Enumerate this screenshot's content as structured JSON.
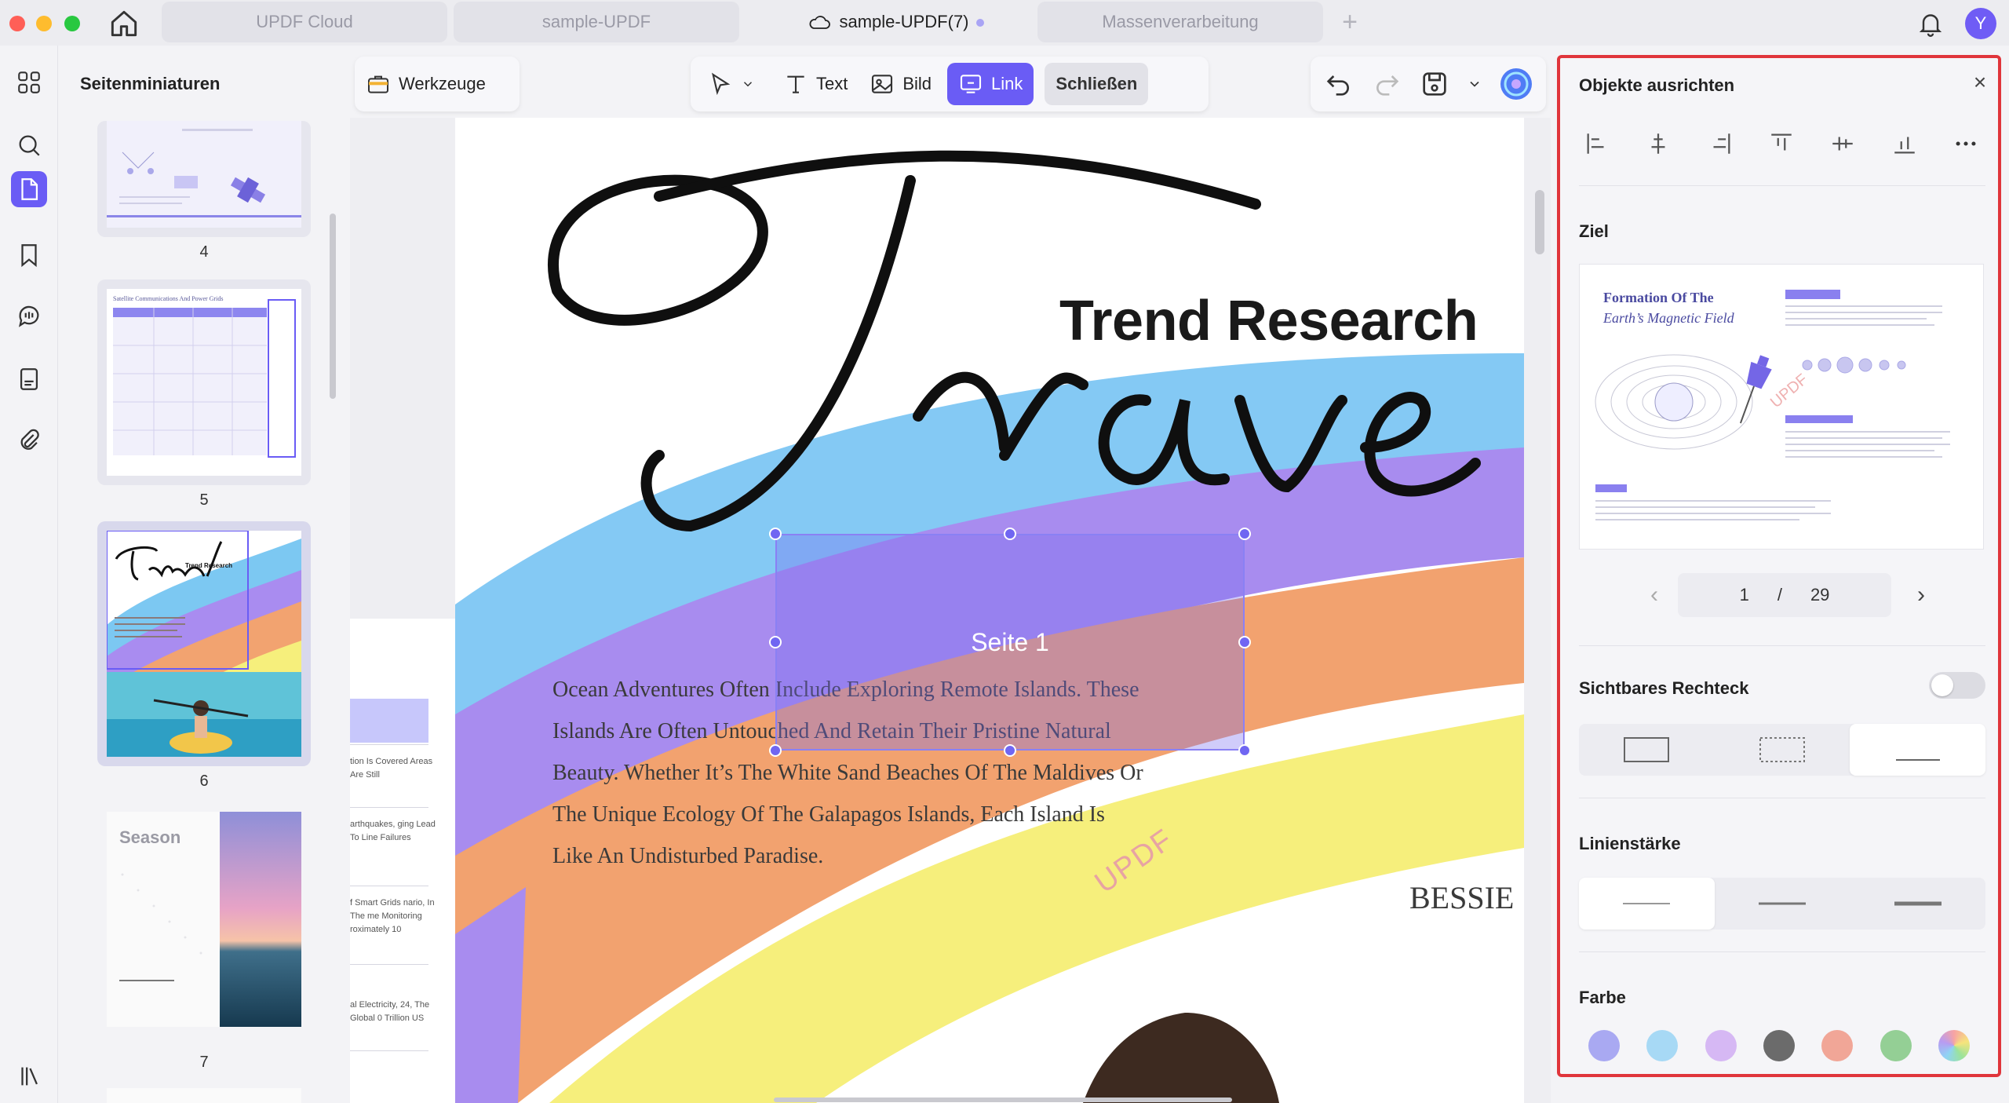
{
  "tabs": [
    {
      "label": "UPDF Cloud"
    },
    {
      "label": "sample-UPDF"
    },
    {
      "label": "sample-UPDF(7)"
    },
    {
      "label": "Massenverarbeitung"
    }
  ],
  "tab_add": "+",
  "user": {
    "avatar_initial": "Y",
    "accent": "#6a5cf5"
  },
  "thumbnails": {
    "title": "Seitenminiaturen",
    "pages": [
      {
        "number": "4"
      },
      {
        "number": "5",
        "header": "Satellite Communications And Power Grids"
      },
      {
        "number": "6",
        "mini_title": "Trend Research"
      },
      {
        "number": "7",
        "mini_title": "Season"
      }
    ]
  },
  "toolbar": {
    "tools_label": "Werkzeuge",
    "text_label": "Text",
    "image_label": "Bild",
    "link_label": "Link",
    "close_label": "Schließen"
  },
  "document": {
    "heading": "Trend Research",
    "paragraph": "Ocean Adventures Often Include Exploring Remote Islands. These Islands Are Often Untouched And Retain Their Pristine Natural Beauty. Whether It’s The White Sand Beaches Of The Maldives Or The Unique Ecology Of The Galapagos Islands, Each Island Is Like An Undisturbed Paradise.",
    "author": "BESSIE",
    "watermark": "UPDF",
    "link_box_label": "Seite 1",
    "left_page_snippets": [
      "tion Is Covered Areas Are Still",
      "arthquakes, ging Lead To Line Failures",
      "f Smart Grids nario, In The me Monitoring roximately 10",
      "al Electricity, 24, The Global 0 Trillion US"
    ]
  },
  "panel": {
    "title": "Objekte ausrichten",
    "close": "×",
    "target_label": "Ziel",
    "preview_title_line1": "Formation Of The",
    "preview_title_line2": "Earth’s Magnetic Field",
    "preview_watermark": "UPDF",
    "current_page": "1",
    "page_separator": "/",
    "total_pages": "29",
    "visible_rect_label": "Sichtbares Rechteck",
    "visible_rect_on": false,
    "line_width_label": "Linienstärke",
    "color_label": "Farbe",
    "colors": [
      "#a9a9f2",
      "#a7d9f5",
      "#d6b8f4",
      "#6b6b6b",
      "#f1a697",
      "#94cf95",
      "rainbow"
    ],
    "border_color": "#e0353b"
  }
}
